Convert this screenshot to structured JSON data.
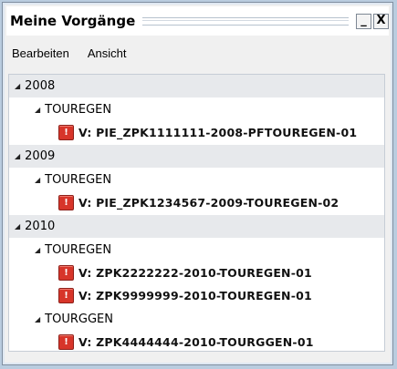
{
  "window": {
    "title": "Meine Vorgänge",
    "buttons": {
      "minimize": "_",
      "close": "X"
    }
  },
  "menu": [
    "Bearbeiten",
    "Ansicht"
  ],
  "tree": {
    "years": [
      {
        "label": "2008",
        "groups": [
          {
            "label": "TOUREGEN",
            "items": [
              "V: PIE_ZPK1111111-2008-PFTOUREGEN-01"
            ]
          }
        ]
      },
      {
        "label": "2009",
        "groups": [
          {
            "label": "TOUREGEN",
            "items": [
              "V: PIE_ZPK1234567-2009-TOUREGEN-02"
            ]
          }
        ]
      },
      {
        "label": "2010",
        "groups": [
          {
            "label": "TOUREGEN",
            "items": [
              "V: ZPK2222222-2010-TOUREGEN-01",
              "V: ZPK9999999-2010-TOUREGEN-01"
            ]
          },
          {
            "label": "TOURGGEN",
            "items": [
              "V: ZPK4444444-2010-TOURGGEN-01"
            ]
          }
        ]
      }
    ],
    "expand_glyph": "◢",
    "status_icon": "stop-icon",
    "status_glyph": "!"
  },
  "colors": {
    "status_red": "#d7352a",
    "year_row_bg": "#e7e9ec"
  }
}
